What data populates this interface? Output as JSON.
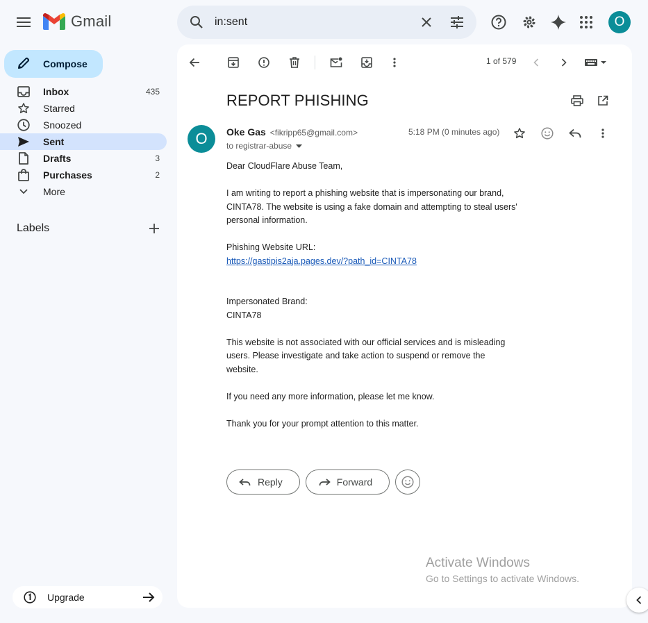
{
  "app": {
    "name": "Gmail",
    "avatar_initial": "O"
  },
  "search": {
    "value": "in:sent"
  },
  "compose": {
    "label": "Compose"
  },
  "nav": {
    "items": [
      {
        "label": "Inbox",
        "count": "435",
        "bold": true
      },
      {
        "label": "Starred",
        "count": "",
        "bold": false
      },
      {
        "label": "Snoozed",
        "count": "",
        "bold": false
      },
      {
        "label": "Sent",
        "count": "",
        "bold": true
      },
      {
        "label": "Drafts",
        "count": "3",
        "bold": true
      },
      {
        "label": "Purchases",
        "count": "2",
        "bold": true
      },
      {
        "label": "More",
        "count": "",
        "bold": false
      }
    ]
  },
  "labels": {
    "title": "Labels"
  },
  "upgrade": {
    "label": "Upgrade"
  },
  "toolbar": {
    "pager": "1 of 579"
  },
  "email": {
    "subject": "REPORT PHISHING",
    "sender_initial": "O",
    "sender_name": "Oke Gas",
    "sender_email": "<fikripp65@gmail.com>",
    "to": "to registrar-abuse",
    "time": "5:18 PM (0 minutes ago)",
    "greeting": "Dear CloudFlare Abuse Team,",
    "para1": "I am writing to report a phishing website that is impersonating our brand, CINTA78. The website is using a fake domain and attempting to steal users' personal information.",
    "url_label": "Phishing Website URL:",
    "url": "https://gastipis2aja.pages.dev/?path_id=CINTA78",
    "brand_label": "Impersonated Brand:",
    "brand": "CINTA78",
    "para2": "This website is not associated with our official services and is misleading users. Please investigate and take action to suspend or remove the website.",
    "para3": "If you need any more information, please let me know.",
    "para4": "Thank you for your prompt attention to this matter."
  },
  "actions": {
    "reply": "Reply",
    "forward": "Forward"
  },
  "watermark": {
    "line1": "Activate Windows",
    "line2": "Go to Settings to activate Windows."
  }
}
